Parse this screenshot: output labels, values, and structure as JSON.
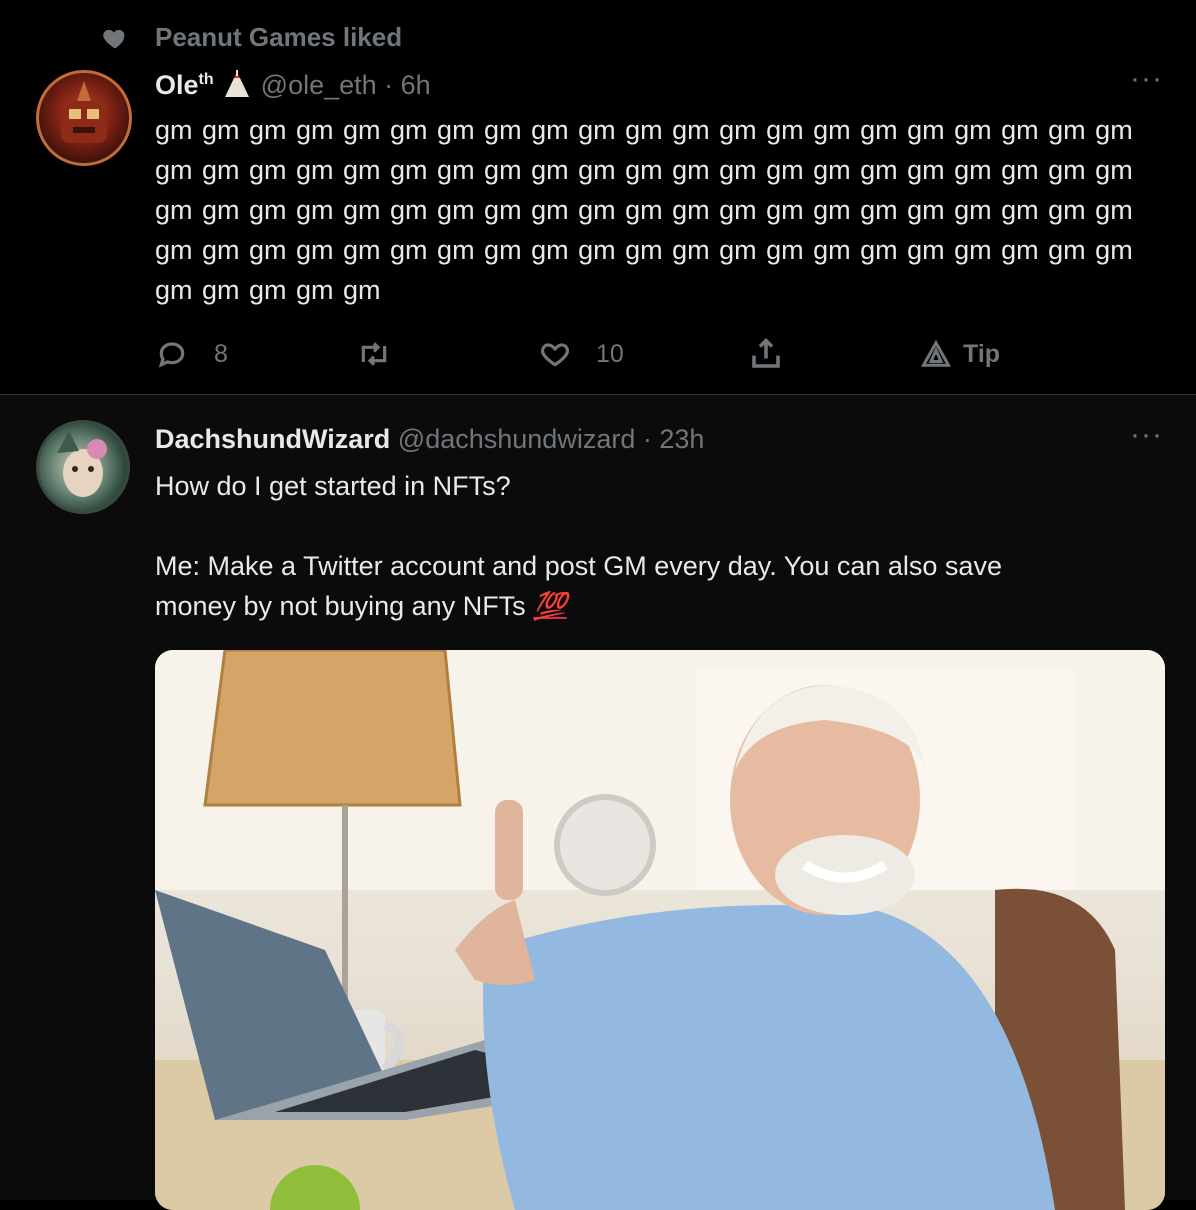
{
  "liked_banner": {
    "text": "Peanut Games liked"
  },
  "tweet1": {
    "name": "Ole",
    "name_sup": "th",
    "handle_time": "@ole_eth · 6h",
    "text": "gm gm gm gm gm gm gm gm gm gm gm gm gm gm gm gm gm gm gm gm gm gm gm gm gm gm gm gm gm gm gm gm gm gm gm gm gm gm gm gm gm gm gm gm gm gm gm gm gm gm gm gm gm gm gm gm gm gm gm gm gm gm gm gm gm gm gm gm gm gm gm gm gm gm gm gm gm gm gm gm gm gm gm gm gm gm gm gm gm",
    "replies": "8",
    "likes": "10",
    "tip_label": "Tip"
  },
  "tweet2": {
    "name": "DachshundWizard",
    "handle_time": "@dachshundwizard · 23h",
    "line1": "How do I get started in NFTs?",
    "line2": "Me: Make a Twitter account and post GM every day. You can also save",
    "line3": "money by not buying any NFTs",
    "emoji": "💯"
  },
  "colors": {
    "background": "#000000",
    "muted": "#71767b",
    "text": "#e7e9ea"
  }
}
